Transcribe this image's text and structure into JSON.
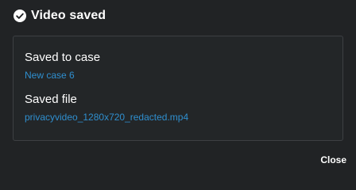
{
  "dialog": {
    "title": "Video saved",
    "icon": "check-circle-icon",
    "accent_color": "#2f8fcf",
    "case": {
      "label": "Saved to case",
      "value": "New case 6"
    },
    "file": {
      "label": "Saved file",
      "value": "privacyvideo_1280x720_redacted.mp4"
    },
    "close_label": "Close"
  }
}
